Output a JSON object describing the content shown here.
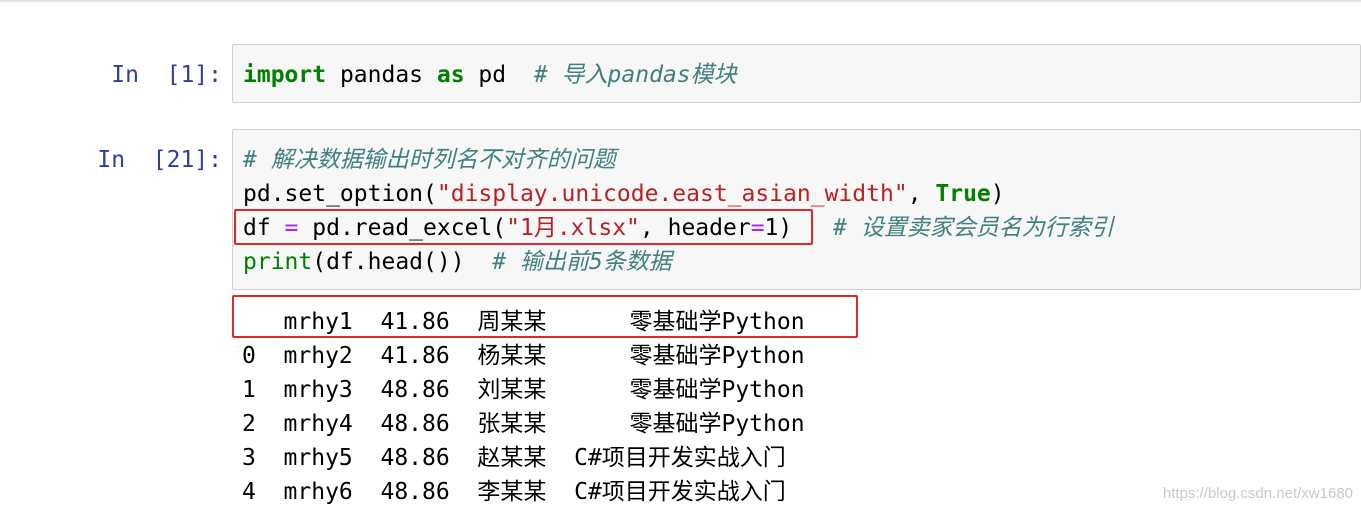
{
  "cells": [
    {
      "prompt": "In  [1]:",
      "code": {
        "l1_kw1": "import",
        "l1_t1": " pandas ",
        "l1_kw2": "as",
        "l1_t2": " pd  ",
        "l1_cm": "# 导入pandas模块"
      }
    },
    {
      "prompt": "In  [21]:",
      "code": {
        "l1_cm": "# 解决数据输出时列名不对齐的问题",
        "l2_t1": "pd.set_option(",
        "l2_str": "\"display.unicode.east_asian_width\"",
        "l2_t2": ", ",
        "l2_kw": "True",
        "l2_t3": ")",
        "l3_t1": "df ",
        "l3_op1": "=",
        "l3_t2": " pd.read_excel(",
        "l3_str": "\"1月.xlsx\"",
        "l3_t3": ", header",
        "l3_op2": "=",
        "l3_t4": "1)",
        "l3_cm": "# 设置卖家会员名为行索引",
        "l4_fn": "print",
        "l4_t1": "(df.head())  ",
        "l4_cm": "# 输出前5条数据"
      }
    }
  ],
  "output": [
    "   mrhy1  41.86  周某某      零基础学Python",
    "0  mrhy2  41.86  杨某某      零基础学Python",
    "1  mrhy3  48.86  刘某某      零基础学Python",
    "2  mrhy4  48.86  张某某      零基础学Python",
    "3  mrhy5  48.86  赵某某  C#项目开发实战入门",
    "4  mrhy6  48.86  李某某  C#项目开发实战入门"
  ],
  "watermark": "https://blog.csdn.net/xw1680",
  "colors": {
    "prompt": "#303f9f",
    "keyword": "#008000",
    "string": "#ba2121",
    "operator": "#aa22ff",
    "comment": "#408080",
    "highlight_box": "#e0272d"
  }
}
